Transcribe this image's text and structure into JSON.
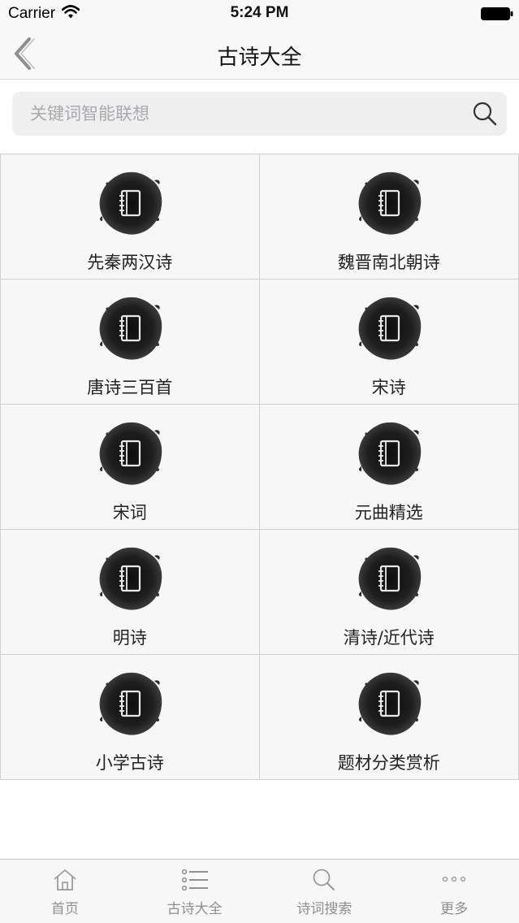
{
  "status_bar": {
    "carrier": "Carrier",
    "time": "5:24 PM"
  },
  "nav": {
    "title": "古诗大全",
    "back_icon": "chevron-left-icon"
  },
  "search": {
    "placeholder": "关键词智能联想",
    "value": "",
    "icon": "search-icon"
  },
  "categories": [
    {
      "label": "先秦两汉诗",
      "icon": "notebook-icon"
    },
    {
      "label": "魏晋南北朝诗",
      "icon": "notebook-icon"
    },
    {
      "label": "唐诗三百首",
      "icon": "notebook-icon"
    },
    {
      "label": "宋诗",
      "icon": "notebook-icon"
    },
    {
      "label": "宋词",
      "icon": "notebook-icon"
    },
    {
      "label": "元曲精选",
      "icon": "notebook-icon"
    },
    {
      "label": "明诗",
      "icon": "notebook-icon"
    },
    {
      "label": "清诗/近代诗",
      "icon": "notebook-icon"
    },
    {
      "label": "小学古诗",
      "icon": "notebook-icon"
    },
    {
      "label": "题材分类赏析",
      "icon": "notebook-icon"
    }
  ],
  "tab_bar": {
    "tabs": [
      {
        "label": "首页",
        "icon": "home-icon"
      },
      {
        "label": "古诗大全",
        "icon": "list-icon"
      },
      {
        "label": "诗词搜索",
        "icon": "search-icon"
      },
      {
        "label": "更多",
        "icon": "more-icon"
      }
    ]
  },
  "colors": {
    "bar_background": "#f8f8f8",
    "cell_background": "#f7f7f8",
    "tab_inactive": "#8f8f94",
    "ink": "#161616"
  }
}
